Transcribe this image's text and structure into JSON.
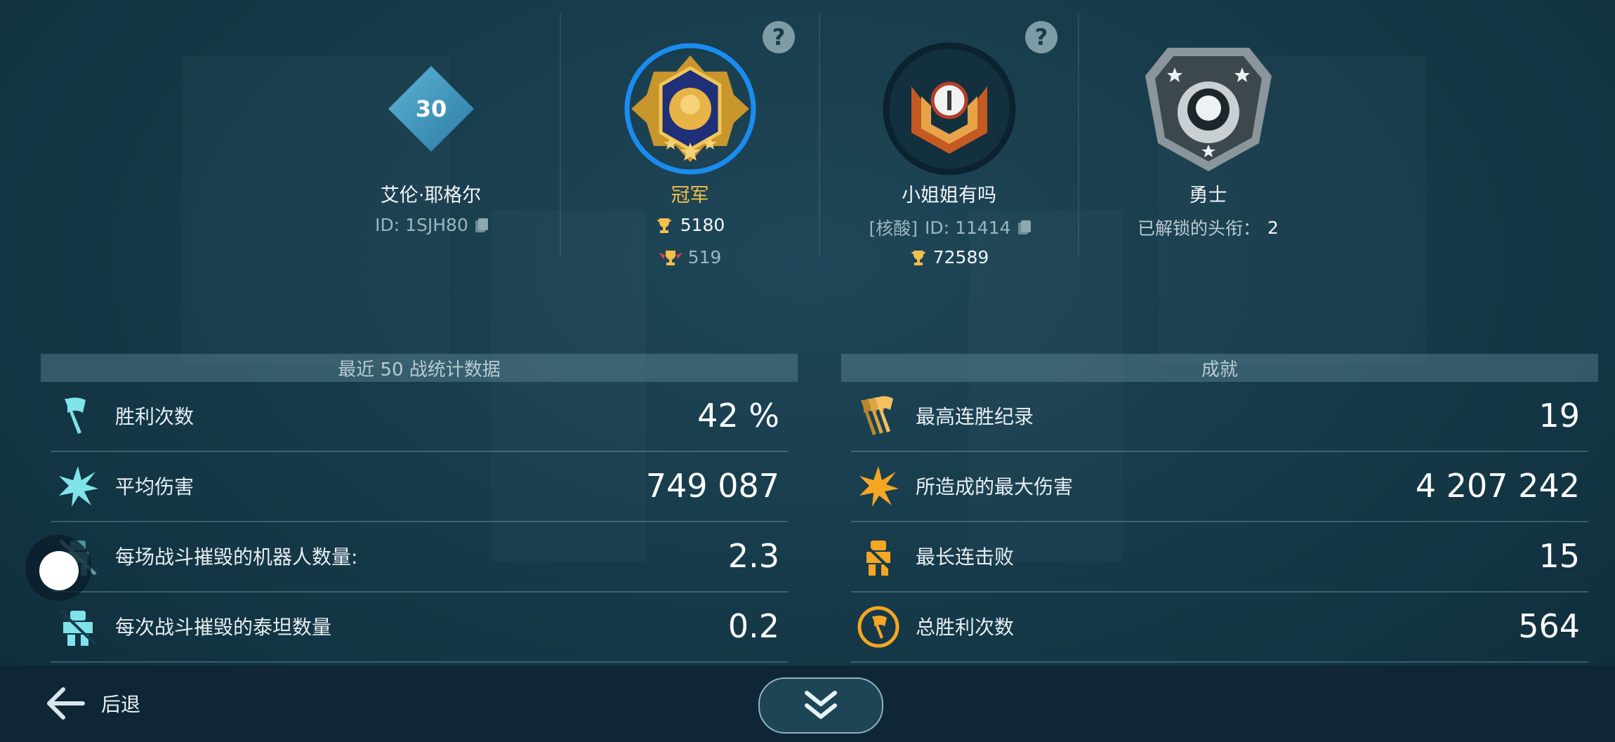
{
  "profile": {
    "level": "30",
    "name": "艾伦·耶格尔",
    "id_text": "ID: 1SJH80"
  },
  "league": {
    "name": "冠军",
    "trophies": "5180",
    "sub_trophies": "519"
  },
  "clan": {
    "name": "小姐姐有吗",
    "tag": "[核酸]",
    "id_text": "ID: 11414",
    "trophies": "72589"
  },
  "title_badge": {
    "name": "勇士",
    "unlocked_label": "已解锁的头衔：",
    "unlocked_count": "2"
  },
  "help_mark": "?",
  "stats_panel": {
    "header": "最近 50 战统计数据",
    "rows": [
      {
        "label": "胜利次数",
        "value": "42 %",
        "icon": "flag-icon"
      },
      {
        "label": "平均伤害",
        "value": "749 087",
        "icon": "burst-icon"
      },
      {
        "label": "每场战斗摧毁的机器人数量:",
        "value": "2.3",
        "icon": "robot-destroyed-icon"
      },
      {
        "label": "每次战斗摧毁的泰坦数量",
        "value": "0.2",
        "icon": "titan-destroyed-icon"
      }
    ]
  },
  "achievements_panel": {
    "header": "成就",
    "rows": [
      {
        "label": "最高连胜纪录",
        "value": "19",
        "icon": "multi-flag-icon"
      },
      {
        "label": "所造成的最大伤害",
        "value": "4 207 242",
        "icon": "burst-icon"
      },
      {
        "label": "最长连击败",
        "value": "15",
        "icon": "robot-destroyed-icon"
      },
      {
        "label": "总胜利次数",
        "value": "564",
        "icon": "flag-circle-icon"
      }
    ]
  },
  "nav": {
    "back_label": "后退"
  },
  "colors": {
    "accent_gold": "#f3c04a",
    "accent_blue": "#1a8cf0",
    "cyan_icon": "#7fe3ea",
    "orange_icon": "#f5a623"
  }
}
